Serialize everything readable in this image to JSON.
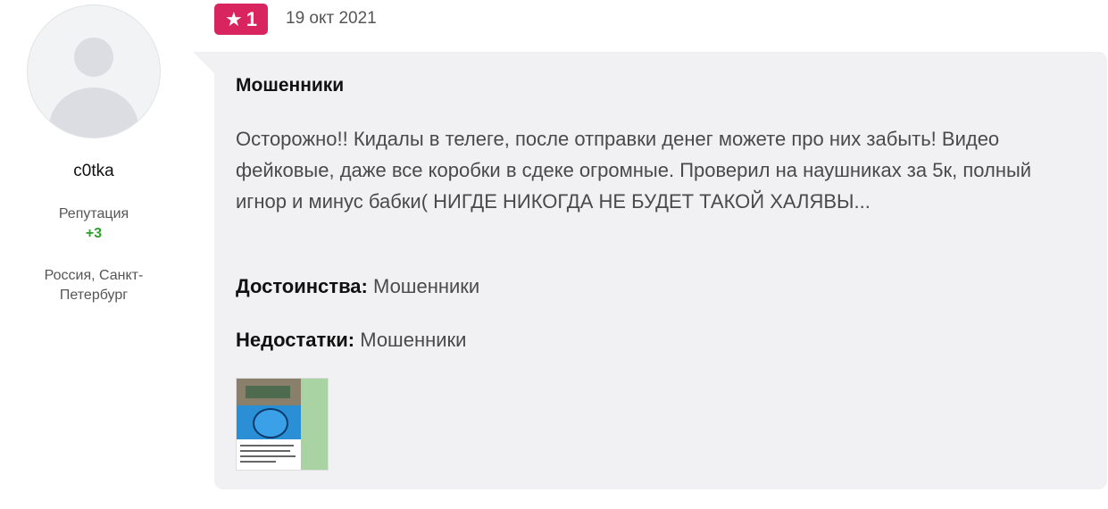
{
  "user": {
    "name": "c0tka",
    "reputation_label": "Репутация",
    "reputation_value": "+3",
    "location": "Россия, Санкт-Петербург"
  },
  "review": {
    "rating": "1",
    "rating_icon": "star-icon",
    "date": "19 окт 2021",
    "title": "Мошенники",
    "text": "Осторожно!! Кидалы в телеге, после отправки денег можете про них забыть! Видео фейковые, даже все коробки в сдеке огромные. Проверил на наушниках за 5к, полный игнор и минус бабки( НИГДЕ НИКОГДА НЕ БУДЕТ ТАКОЙ ХАЛЯВЫ...",
    "pros_label": "Достоинства:",
    "pros_value": "Мошенники",
    "cons_label": "Недостатки:",
    "cons_value": "Мошенники"
  },
  "colors": {
    "rating_badge": "#d8245f",
    "reputation": "#2e9e2e",
    "bubble": "#f1f1f3"
  }
}
